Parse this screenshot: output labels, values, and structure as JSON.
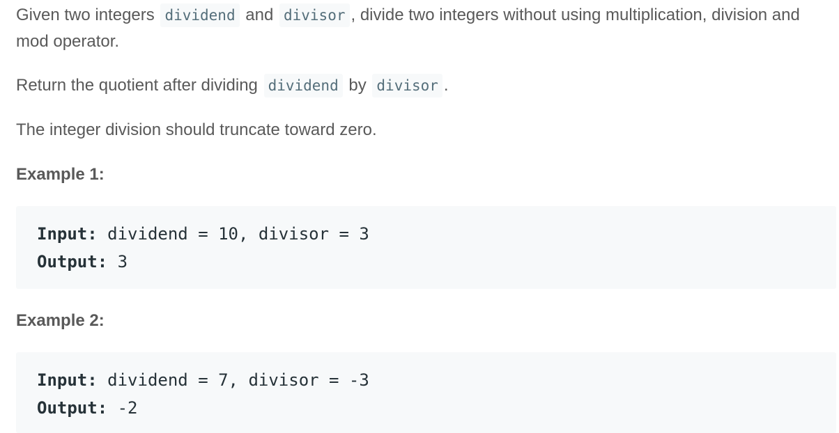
{
  "intro": {
    "t1": "Given two integers ",
    "c1": "dividend",
    "t2": " and ",
    "c2": "divisor",
    "t3": ", divide two integers without using multiplication, division and mod operator."
  },
  "return_line": {
    "t1": "Return the quotient after dividing ",
    "c1": "dividend",
    "t2": " by ",
    "c2": "divisor",
    "t3": "."
  },
  "truncate_line": "The integer division should truncate toward zero.",
  "examples": [
    {
      "title": "Example 1:",
      "input_label": "Input:",
      "input_value": " dividend = 10, divisor = 3",
      "output_label": "Output:",
      "output_value": " 3"
    },
    {
      "title": "Example 2:",
      "input_label": "Input:",
      "input_value": " dividend = 7, divisor = -3",
      "output_label": "Output:",
      "output_value": " -2"
    }
  ]
}
